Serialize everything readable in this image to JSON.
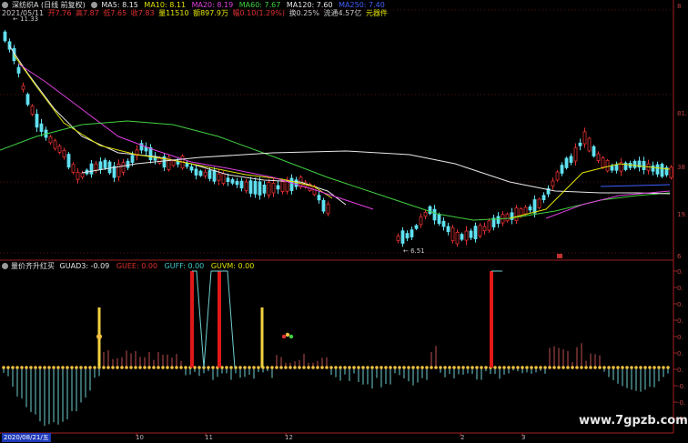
{
  "header": {
    "title": "深纺织A (日线 前复权)",
    "ma5": "MA5: 8.15",
    "ma10": "MA10: 8.11",
    "ma20": "MA20: 8.19",
    "ma60": "MA60: 7.67",
    "ma120": "MA120: 7.60",
    "ma250": "MA250: 7.40",
    "colors": {
      "ma5": "#e8e8e8",
      "ma10": "#e0e000",
      "ma20": "#e040e0",
      "ma60": "#40d040",
      "ma120": "#e8e8e8",
      "ma250": "#4060ff"
    }
  },
  "quote": {
    "date": "2021/05/11",
    "open": "开7.76",
    "high": "高7.87",
    "low": "低7.65",
    "close": "收7.83",
    "volume": "量11510",
    "amount": "额897.9万",
    "change": "幅0.10(1.29%)",
    "turnover": "换0.25%",
    "float_cap": "流通4.57亿",
    "sector": "元器件"
  },
  "price_labels": {
    "high_mark": "11.33",
    "low_mark": "6.51"
  },
  "right_axis": {
    "top": [
      "8",
      "81.",
      "38",
      "19.",
      "6"
    ],
    "bottom": [
      "0.",
      "0.",
      "0.",
      "0.",
      "0.",
      "0.",
      "0.",
      "-0.",
      "-0.",
      "-0."
    ]
  },
  "indicator": {
    "name": "量价齐升红买",
    "guad3": "GUAD3: -0.09",
    "guee": "GUEE: 0.00",
    "guff": "GUFF: 0.00",
    "guvm": "GUVM: 0.00"
  },
  "bottom_axis": {
    "current_date": "2020/08/21/五",
    "ticks": [
      "10",
      "11",
      "12",
      "2",
      "3"
    ]
  },
  "watermark": "www.7gpzb.com"
}
